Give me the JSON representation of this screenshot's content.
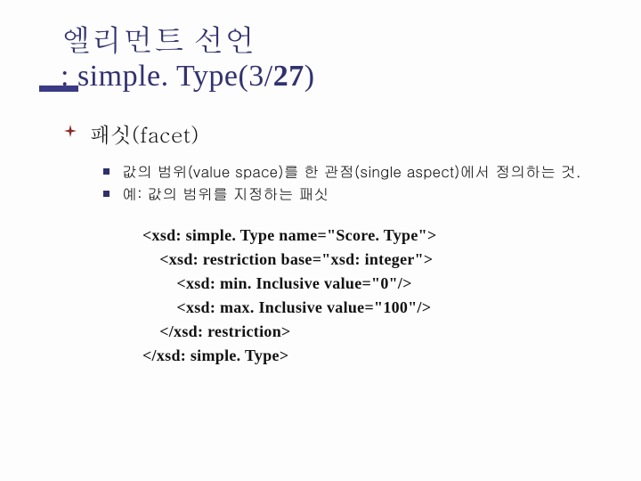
{
  "title": {
    "line1": "엘리먼트 선언",
    "line2_prefix": ": simple. Type(3/",
    "line2_bold": "27",
    "line2_suffix": ")"
  },
  "section": {
    "heading": "패싯(facet)",
    "points": [
      "값의 범위(value space)를 한 관점(single aspect)에서 정의하는 것.",
      "예: 값의 범위를 지정하는 패싯"
    ]
  },
  "code": "<xsd: simple. Type name=\"Score. Type\">\n    <xsd: restriction base=\"xsd: integer\">\n        <xsd: min. Inclusive value=\"0\"/>\n        <xsd: max. Inclusive value=\"100\"/>\n    </xsd: restriction>\n</xsd: simple. Type>"
}
